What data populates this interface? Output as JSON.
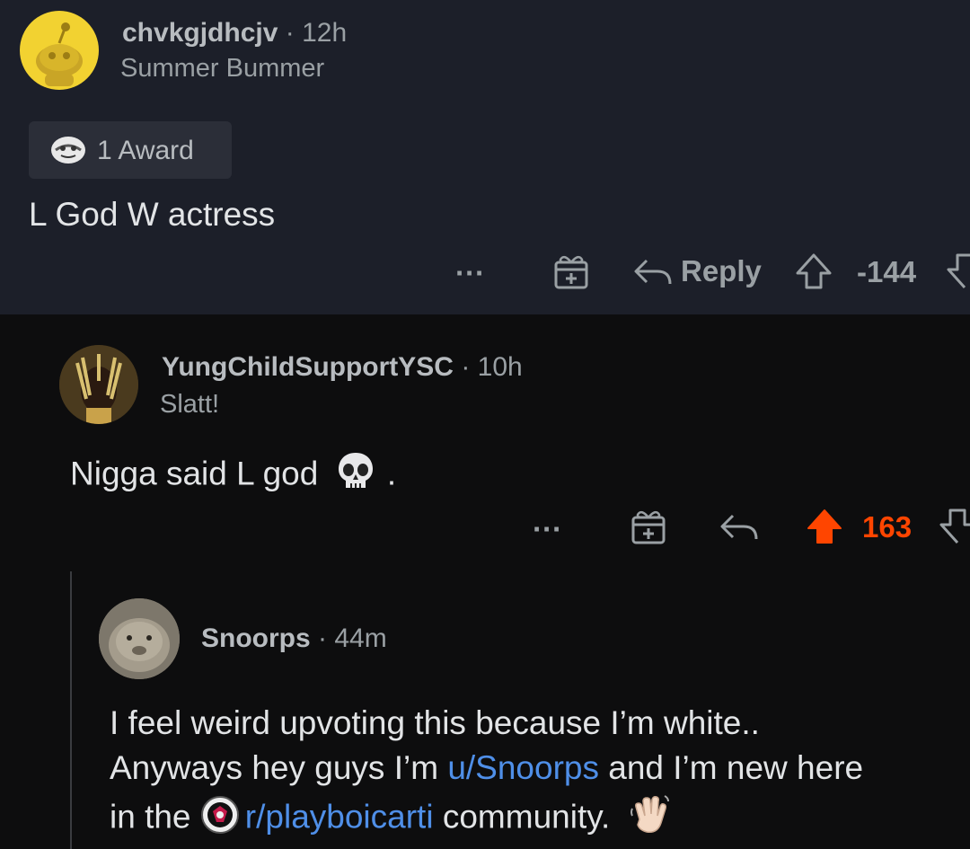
{
  "comments": [
    {
      "username": "chvkgjdhcjv",
      "separator": "·",
      "time": "12h",
      "flair": "Summer Bummer",
      "award_label": "1 Award",
      "body": "L God W actress",
      "actions": {
        "more": "···",
        "reply_label": "Reply",
        "score": "-144"
      },
      "colors": {
        "background": "#1c1f29",
        "avatar": "#f2d231"
      }
    },
    {
      "username": "YungChildSupportYSC",
      "separator": "·",
      "time": "10h",
      "flair": "Slatt!",
      "body": "Nigga said L god",
      "body_suffix": ".",
      "body_emoji": "skull-emoji",
      "actions": {
        "more": "···",
        "score": "163",
        "upvoted": true
      },
      "colors": {
        "background": "#0d0d0e",
        "upvote": "#ff4500"
      }
    },
    {
      "username": "Snoorps",
      "separator": "·",
      "time": "44m",
      "body_line1": "I feel weird upvoting this because I’m white..",
      "body_line2_prefix": "Anyways hey guys I’m ",
      "body_line2_link": "u/Snoorps",
      "body_line2_suffix": " and I’m new here",
      "body_line3_prefix": "in the ",
      "body_line3_link": "r/playboicarti",
      "body_line3_suffix": " community.",
      "body_emoji": "waving-hand-emoji",
      "colors": {
        "link": "#4f8fe8"
      }
    }
  ]
}
